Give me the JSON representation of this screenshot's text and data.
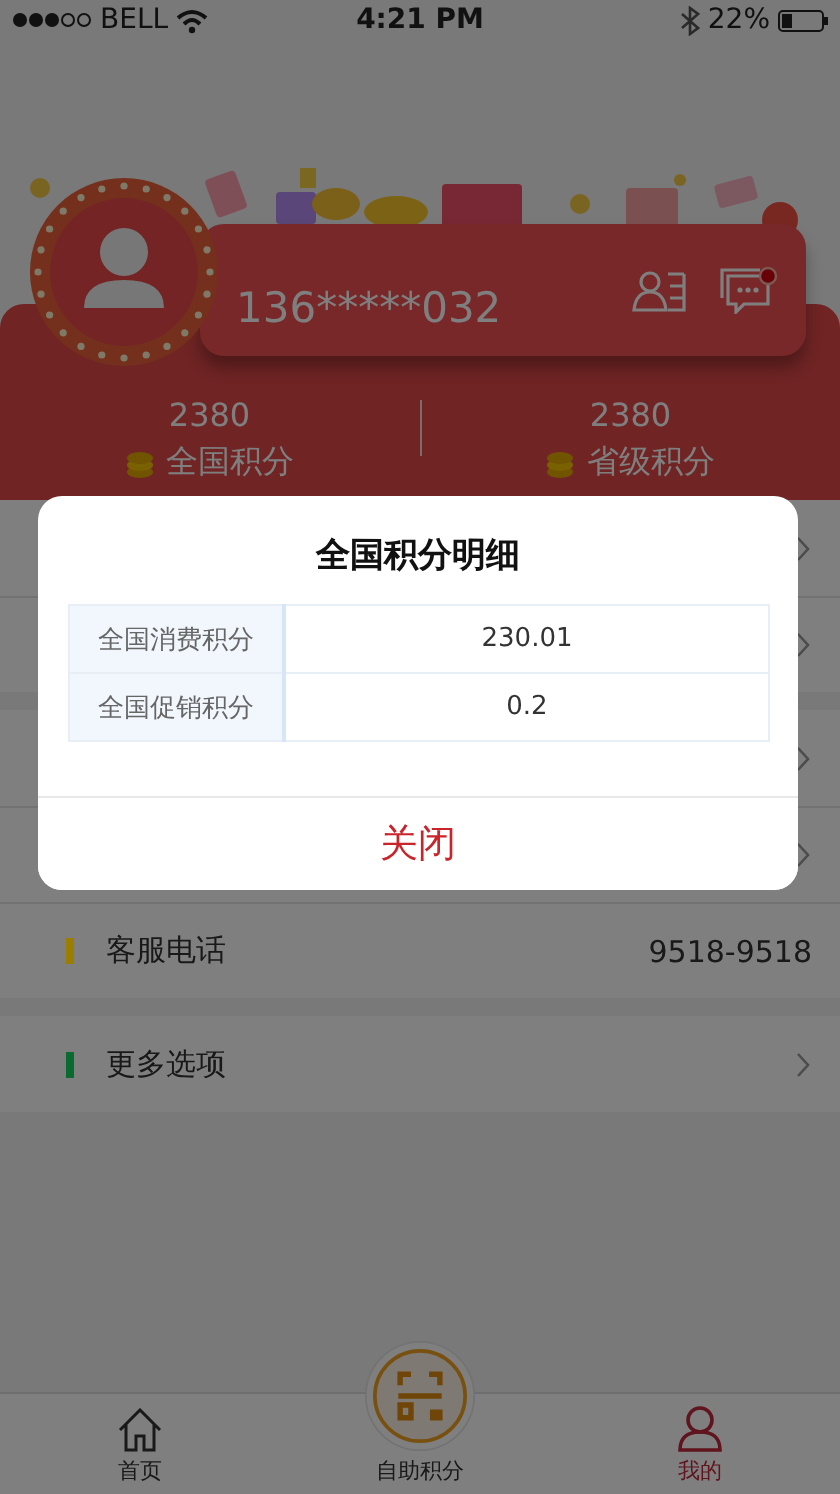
{
  "status_bar": {
    "carrier": "BELL",
    "time": "4:21 PM",
    "battery": "22%"
  },
  "profile": {
    "phone": "136*****032",
    "unread": true
  },
  "points": [
    {
      "value": "2380",
      "label": "全国积分"
    },
    {
      "value": "2380",
      "label": "省级积分"
    }
  ],
  "menu": [
    {
      "items": [
        {
          "chevron": true
        },
        {
          "chevron": true
        }
      ]
    },
    {
      "items": [
        {
          "chevron": true
        },
        {
          "chevron": true
        },
        {
          "label": "客服电话",
          "color": "#9b7d00",
          "value": "9518-9518",
          "chevron": false
        }
      ]
    },
    {
      "items": [
        {
          "label": "更多选项",
          "color": "#0a6b30",
          "chevron": true
        }
      ]
    }
  ],
  "tabs": [
    {
      "kind": "home",
      "label": "首页",
      "selected": false
    },
    {
      "kind": "scan",
      "label": "自助积分",
      "selected": false
    },
    {
      "kind": "profile",
      "label": "我的",
      "selected": true
    }
  ],
  "dialog": {
    "title": "全国积分明细",
    "rows": [
      {
        "label": "全国消费积分",
        "value": "230.01"
      },
      {
        "label": "全国促销积分",
        "value": "0.2"
      }
    ],
    "button": "关闭"
  }
}
